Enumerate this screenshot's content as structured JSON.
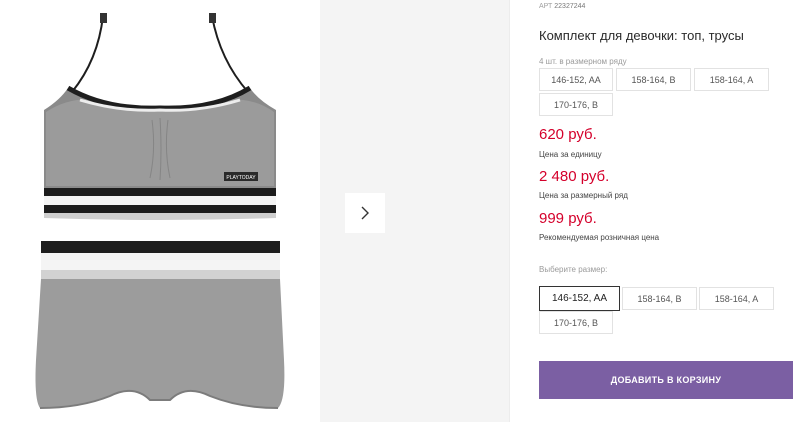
{
  "gallery": {
    "image_label": "PLAYTODAY",
    "next_icon": "chevron-right-icon"
  },
  "product": {
    "sku_label": "АРТ",
    "sku": "22327244",
    "title": "Комплект для девочки: топ, трусы",
    "pack_label": "4 шт. в размерном ряду",
    "pack_sizes": [
      "146-152, AA",
      "158-164, B",
      "158-164, A",
      "170-176, B"
    ]
  },
  "prices": {
    "unit_value": "620 руб.",
    "unit_caption": "Цена за единицу",
    "pack_value": "2 480 руб.",
    "pack_caption": "Цена за размерный ряд",
    "rrp_value": "999 руб.",
    "rrp_caption": "Рекомендуемая розничная цена",
    "color": "#d4002b"
  },
  "size_select": {
    "label": "Выберите размер:",
    "options": [
      "146-152, AA",
      "158-164, B",
      "158-164, A",
      "170-176, B"
    ],
    "selected": "146-152, AA"
  },
  "cart": {
    "button_label": "Добавить в корзину",
    "color": "#7b5fa3"
  }
}
